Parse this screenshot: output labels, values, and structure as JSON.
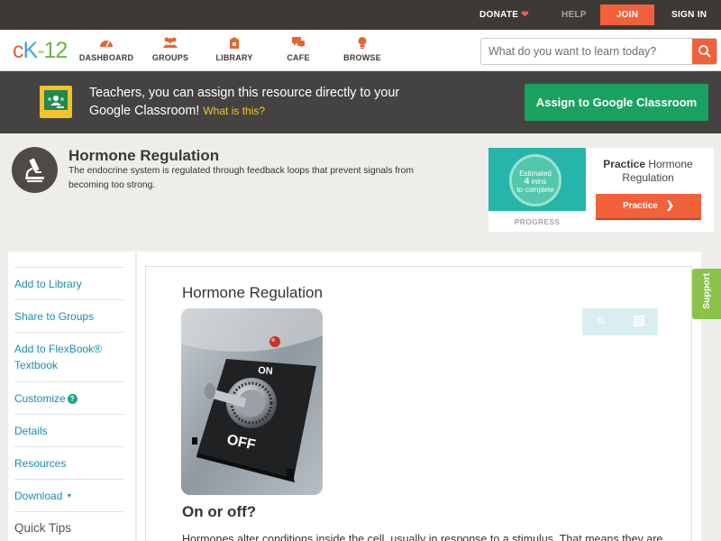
{
  "topbar": {
    "donate": "DONATE",
    "help": "HELP",
    "join": "JOIN",
    "signin": "SIGN IN"
  },
  "brand": {
    "logo_c": "c",
    "logo_k": "K",
    "logo_dash": "-",
    "logo_n": "12"
  },
  "nav": {
    "items": [
      {
        "label": "DASHBOARD",
        "icon": "dashboard-icon"
      },
      {
        "label": "GROUPS",
        "icon": "groups-icon"
      },
      {
        "label": "LIBRARY",
        "icon": "library-icon"
      },
      {
        "label": "CAFE",
        "icon": "cafe-icon"
      },
      {
        "label": "BROWSE",
        "icon": "browse-icon"
      }
    ]
  },
  "search": {
    "placeholder": "What do you want to learn today?"
  },
  "classroom_banner": {
    "text": "Teachers, you can assign this resource directly to your Google Classroom!",
    "link": "What is this?",
    "button": "Assign to Google Classroom"
  },
  "concept": {
    "title": "Hormone Regulation",
    "description": "The endocrine system is regulated through feedback loops that prevent signals from becoming too strong."
  },
  "practice_card": {
    "estimate_line1": "Estimated",
    "estimate_value": "4",
    "estimate_unit": "mins",
    "estimate_line3": "to complete",
    "progress_label": "PROGRESS",
    "title_bold": "Practice",
    "title_rest": "Hormone Regulation",
    "button": "Practice"
  },
  "sidebar": {
    "items": [
      {
        "label": "Add to Library"
      },
      {
        "label": "Share to Groups"
      },
      {
        "label": "Add to FlexBook® Textbook"
      },
      {
        "label": "Customize"
      },
      {
        "label": "Details"
      },
      {
        "label": "Resources"
      },
      {
        "label": "Download"
      },
      {
        "label": "Quick Tips"
      }
    ]
  },
  "content": {
    "title": "Hormone Regulation",
    "photo_on": "ON",
    "photo_off": "OFF",
    "subheading": "On or off?",
    "body": "Hormones alter conditions inside the cell, usually in response to a stimulus. That means they are"
  },
  "support_tab": "Support",
  "colors": {
    "accent_orange": "#f2613a",
    "classroom_green": "#1aa160",
    "link_blue": "#1a8dad",
    "support_green": "#8bc34a",
    "topbar_dark": "#3d3a36"
  }
}
